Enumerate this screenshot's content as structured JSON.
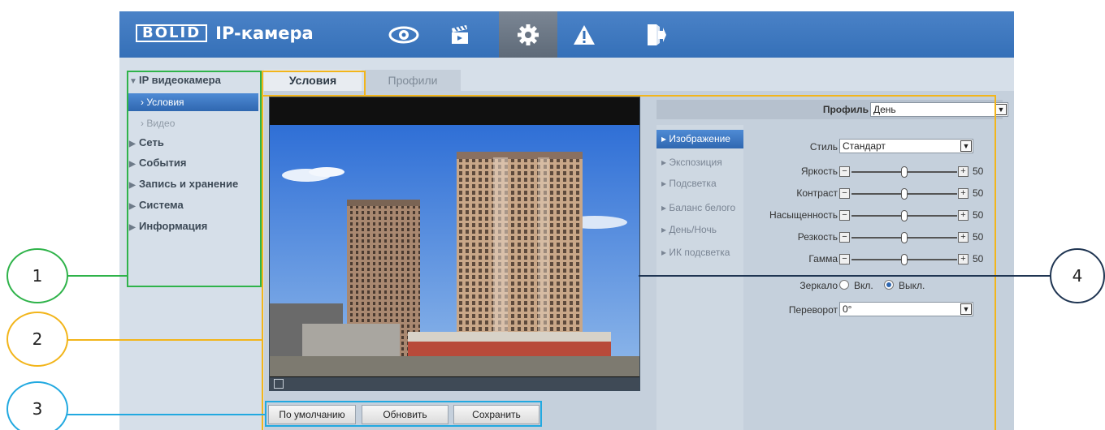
{
  "header": {
    "logo": "BOLID",
    "title": "IP-камера",
    "nav_icons": [
      "eye-icon",
      "clapperboard-icon",
      "gear-icon",
      "warning-icon",
      "exit-icon"
    ],
    "active_icon": "gear-icon"
  },
  "sidebar": {
    "sections": [
      {
        "label": "IP видеокамера",
        "expanded": true
      },
      {
        "label": "Сеть"
      },
      {
        "label": "События"
      },
      {
        "label": "Запись и хранение"
      },
      {
        "label": "Система"
      },
      {
        "label": "Информация"
      }
    ],
    "subitems": [
      {
        "label": "Условия",
        "active": true
      },
      {
        "label": "Видео",
        "active": false
      }
    ]
  },
  "tabs": [
    {
      "label": "Условия",
      "active": true
    },
    {
      "label": "Профили",
      "active": false
    }
  ],
  "buttons": {
    "default": "По умолчанию",
    "refresh": "Обновить",
    "save": "Сохранить"
  },
  "profile": {
    "label": "Профиль",
    "value": "День"
  },
  "menu": [
    {
      "label": "Изображение",
      "active": true
    },
    {
      "label": "Экспозиция"
    },
    {
      "label": "Подсветка"
    },
    {
      "label": "Баланс белого"
    },
    {
      "label": "День/Ночь"
    },
    {
      "label": "ИК подсветка"
    }
  ],
  "settings": {
    "style": {
      "label": "Стиль",
      "value": "Стандарт"
    },
    "sliders": [
      {
        "label": "Яркость",
        "value": "50",
        "level": 0.5
      },
      {
        "label": "Контраст",
        "value": "50",
        "level": 0.5
      },
      {
        "label": "Насыщенность",
        "value": "50",
        "level": 0.5
      },
      {
        "label": "Резкость",
        "value": "50",
        "level": 0.5
      },
      {
        "label": "Гамма",
        "value": "50",
        "level": 0.5
      }
    ],
    "mirror": {
      "label": "Зеркало",
      "on": "Вкл.",
      "off": "Выкл.",
      "selected": "Выкл."
    },
    "flip": {
      "label": "Переворот",
      "value": "0°"
    }
  },
  "annotations": [
    {
      "label": "1",
      "color": "#2fb34a"
    },
    {
      "label": "2",
      "color": "#f2b51b"
    },
    {
      "label": "3",
      "color": "#22a9e0"
    },
    {
      "label": "4",
      "color": "#1f3552"
    }
  ],
  "colors": {
    "header": "#3a75bd",
    "accent": "#2f67b0",
    "panel": "#d6dfe9"
  }
}
